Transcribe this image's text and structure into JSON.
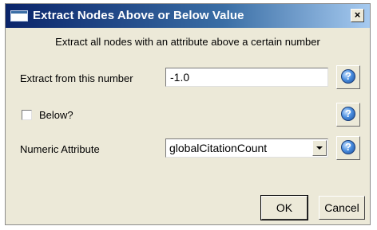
{
  "dialog": {
    "title": "Extract Nodes Above or Below Value",
    "close_label": "×",
    "subtitle": "Extract all nodes with an attribute above a certain number"
  },
  "fields": {
    "extract_from": {
      "label": "Extract from this number",
      "value": "-1.0"
    },
    "below": {
      "label": "Below?",
      "checked": false
    },
    "numeric_attribute": {
      "label": "Numeric Attribute",
      "selected": "globalCitationCount"
    }
  },
  "help": {
    "glyph": "?"
  },
  "buttons": {
    "ok": "OK",
    "cancel": "Cancel"
  }
}
